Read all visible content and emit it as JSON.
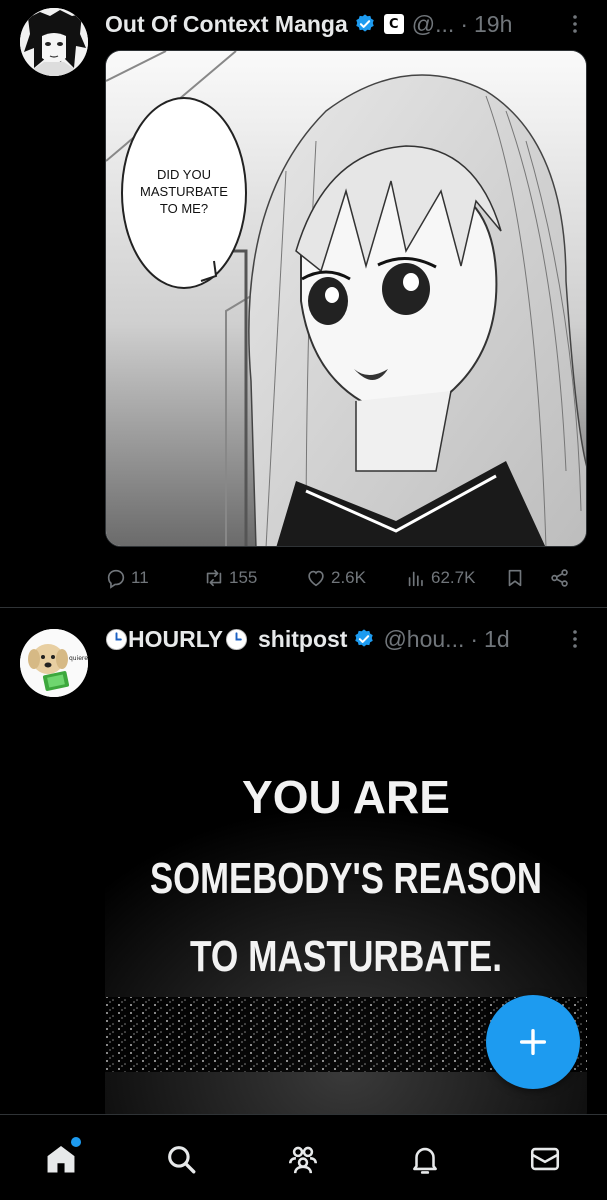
{
  "tweets": [
    {
      "display_name": "Out Of Context Manga",
      "handle": "@...",
      "separator": "·",
      "time": "19h",
      "affiliate_badge": "C",
      "image_text": "DID YOU MASTURBATE TO ME?",
      "image_text_lines": [
        "DID YOU",
        "MASTURBATE",
        "TO ME?"
      ],
      "stats": {
        "replies": "11",
        "reposts": "155",
        "likes": "2.6K",
        "views": "62.7K"
      }
    },
    {
      "display_name_prefix": "HOURLY",
      "display_name_suffix": "shitpost",
      "handle": "@hou...",
      "separator": "·",
      "time": "1d",
      "avatar_text": "quieres",
      "image_text_lines": [
        "YOU ARE",
        "SOMEBODY'S REASON",
        "TO MASTURBATE."
      ]
    }
  ],
  "colors": {
    "accent": "#1d9bf0",
    "background": "#000000",
    "text_primary": "#e7e9ea",
    "text_secondary": "#71767b",
    "divider": "#2f3336"
  },
  "icons": {
    "fab": "plus-icon",
    "nav": [
      "home-icon",
      "search-icon",
      "communities-icon",
      "notifications-icon",
      "messages-icon"
    ]
  }
}
